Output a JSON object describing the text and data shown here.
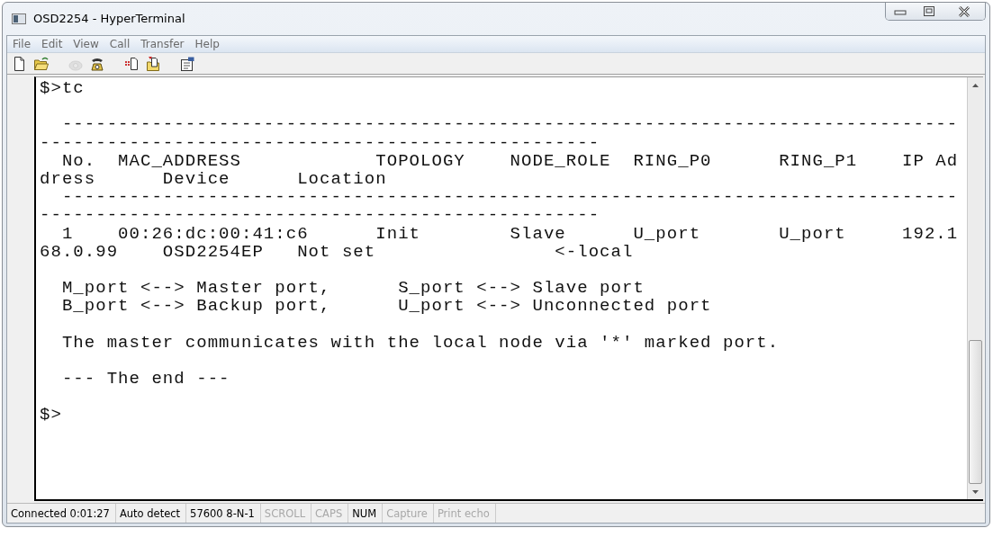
{
  "window": {
    "title": "OSD2254 - HyperTerminal"
  },
  "menu": [
    "File",
    "Edit",
    "View",
    "Call",
    "Transfer",
    "Help"
  ],
  "toolbar": [
    {
      "kind": "new",
      "disabled": false
    },
    {
      "kind": "open",
      "disabled": false
    },
    {
      "kind": "sep"
    },
    {
      "kind": "disconnect",
      "disabled": true
    },
    {
      "kind": "dial",
      "disabled": false
    },
    {
      "kind": "sep"
    },
    {
      "kind": "send",
      "disabled": false
    },
    {
      "kind": "receive",
      "disabled": false
    },
    {
      "kind": "sep"
    },
    {
      "kind": "properties",
      "disabled": false
    }
  ],
  "terminal": {
    "lines": [
      {
        "kind": "text",
        "text": "$>tc"
      },
      {
        "kind": "blank"
      },
      {
        "kind": "text",
        "text": "  --------------------------------------------------------------------------------"
      },
      {
        "kind": "text",
        "text": "--------------------------------------------------"
      },
      {
        "kind": "text",
        "text": "  No.  MAC_ADDRESS            TOPOLOGY    NODE_ROLE  RING_P0      RING_P1    IP Ad"
      },
      {
        "kind": "text",
        "text": "dress      Device      Location"
      },
      {
        "kind": "text",
        "text": "  --------------------------------------------------------------------------------"
      },
      {
        "kind": "text",
        "text": "--------------------------------------------------"
      },
      {
        "kind": "text",
        "text": "  1    00:26:dc:00:41:c6      Init        Slave      U_port       U_port     192.1"
      },
      {
        "kind": "text",
        "text": "68.0.99    OSD2254EP   Not set                <-local"
      },
      {
        "kind": "blank"
      },
      {
        "kind": "text",
        "text": "  M_port <--> Master port,      S_port <--> Slave port"
      },
      {
        "kind": "text",
        "text": "  B_port <--> Backup port,      U_port <--> Unconnected port"
      },
      {
        "kind": "blank"
      },
      {
        "kind": "text",
        "text": "  The master communicates with the local node via '*' marked port."
      },
      {
        "kind": "blank"
      },
      {
        "kind": "text",
        "text": "  --- The end ---"
      },
      {
        "kind": "blank"
      },
      {
        "kind": "text",
        "text": "$>"
      }
    ]
  },
  "status_bar": [
    {
      "text": "Connected 0:01:27",
      "on": true
    },
    {
      "text": "Auto detect",
      "on": true
    },
    {
      "text": "57600 8-N-1",
      "on": true
    },
    {
      "text": "SCROLL",
      "on": false
    },
    {
      "text": "CAPS",
      "on": false
    },
    {
      "text": "NUM",
      "on": true
    },
    {
      "text": "Capture",
      "on": false
    },
    {
      "text": "Print echo",
      "on": false
    }
  ]
}
